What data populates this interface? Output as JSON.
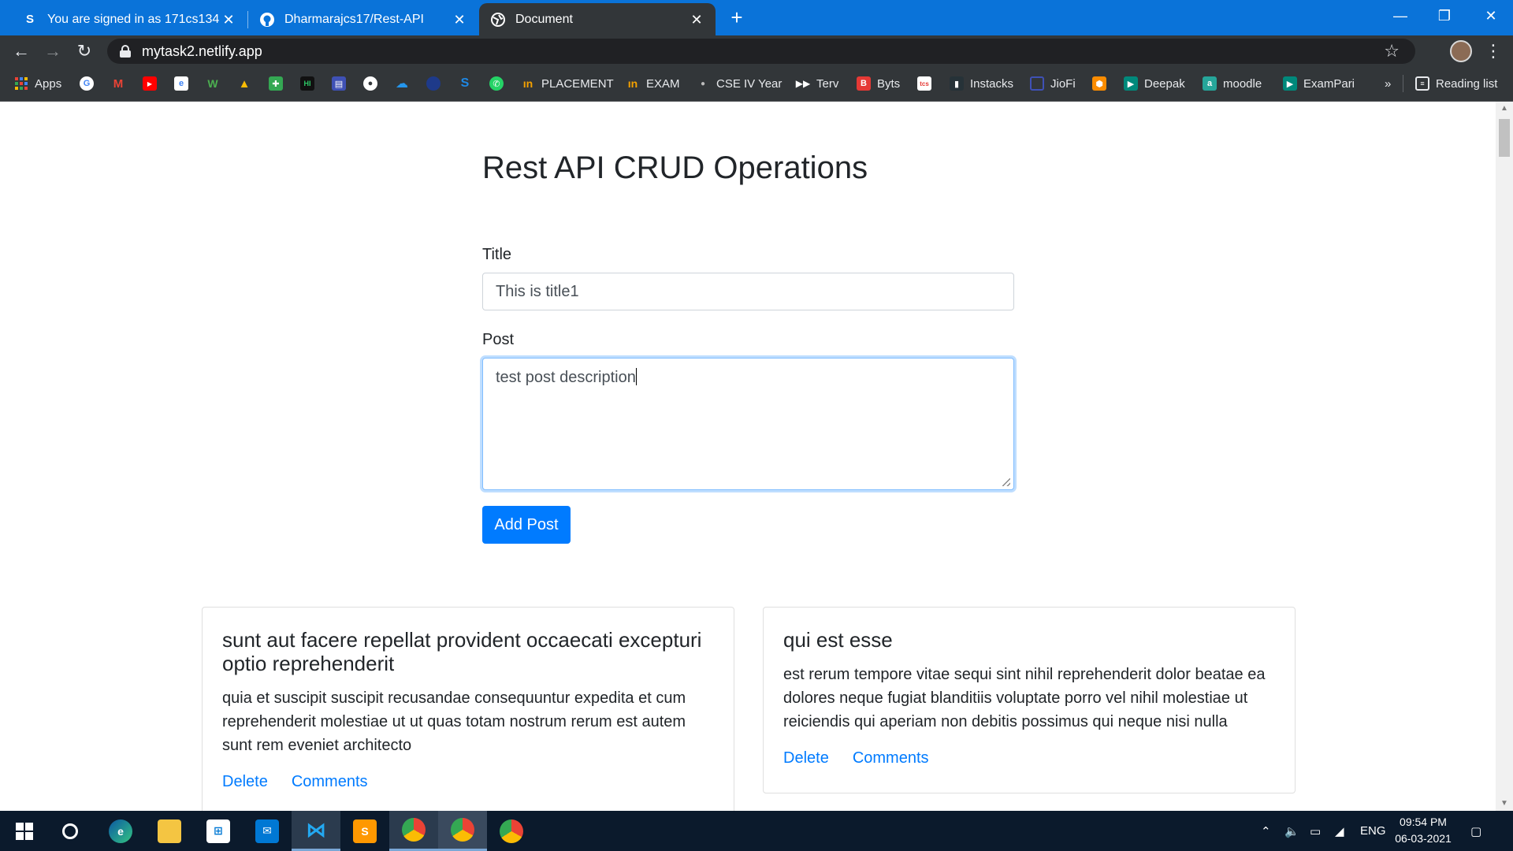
{
  "browser": {
    "tabs": [
      {
        "title": "You are signed in as 171cs134",
        "favicon": "S"
      },
      {
        "title": "Dharmarajcs17/Rest-API",
        "favicon": "github-icon"
      },
      {
        "title": "Document",
        "favicon": "globe-icon"
      }
    ],
    "url": "mytask2.netlify.app",
    "bookmarks": [
      {
        "label": "Apps",
        "icon": "apps-grid-icon",
        "color": "#ea4335"
      },
      {
        "label": "",
        "icon": "google-icon",
        "color": "#4285f4"
      },
      {
        "label": "",
        "icon": "gmail-icon",
        "color": "#ea4335"
      },
      {
        "label": "",
        "icon": "youtube-icon",
        "color": "#ff0000"
      },
      {
        "label": "",
        "icon": "editor-icon",
        "color": "#3b82f6"
      },
      {
        "label": "",
        "icon": "w-icon",
        "color": "#4caf50"
      },
      {
        "label": "",
        "icon": "drive-icon",
        "color": "#fbbc04"
      },
      {
        "label": "",
        "icon": "maps-icon",
        "color": "#34a853"
      },
      {
        "label": "",
        "icon": "hackerrank-icon",
        "color": "#111111"
      },
      {
        "label": "",
        "icon": "calendar-icon",
        "color": "#3f51b5"
      },
      {
        "label": "",
        "icon": "github-icon",
        "color": "#ffffff"
      },
      {
        "label": "",
        "icon": "docker-icon",
        "color": "#2496ed"
      },
      {
        "label": "",
        "icon": "dot-icon",
        "color": "#1e3a8a"
      },
      {
        "label": "",
        "icon": "s-icon",
        "color": "#1e88e5"
      },
      {
        "label": "",
        "icon": "whatsapp-icon",
        "color": "#25d366"
      },
      {
        "label": "PLACEMENT",
        "icon": "placement-icon",
        "color": "#f4a100"
      },
      {
        "label": "EXAM",
        "icon": "exam-icon",
        "color": "#f4a100"
      },
      {
        "label": "CSE IV Year",
        "icon": "dot-icon",
        "color": "#555555"
      },
      {
        "label": "Terv",
        "icon": "terv-icon",
        "color": "#ffffff"
      },
      {
        "label": "Byts",
        "icon": "byts-icon",
        "color": "#e53935"
      },
      {
        "label": "",
        "icon": "tcs-icon",
        "color": "#e53935"
      },
      {
        "label": "Instacks",
        "icon": "instacks-icon",
        "color": "#263238"
      },
      {
        "label": "JioFi",
        "icon": "jiofi-icon",
        "color": "#3f51b5"
      },
      {
        "label": "",
        "icon": "box-icon",
        "color": "#fb8c00"
      },
      {
        "label": "Deepak",
        "icon": "meet-icon",
        "color": "#00897b"
      },
      {
        "label": "moodle",
        "icon": "moodle-icon",
        "color": "#26a69a"
      },
      {
        "label": "ExamPari",
        "icon": "meet-icon",
        "color": "#00897b"
      }
    ],
    "reading_list": "Reading list",
    "more_bookmarks": "»"
  },
  "page": {
    "heading": "Rest API CRUD Operations",
    "title_label": "Title",
    "title_value": "This is title1",
    "post_label": "Post",
    "post_value": "test post description",
    "add_button": "Add Post",
    "posts": [
      {
        "title": "sunt aut facere repellat provident occaecati excepturi optio reprehenderit",
        "body": "quia et suscipit suscipit recusandae consequuntur expedita et cum reprehenderit molestiae ut ut quas totam nostrum rerum est autem sunt rem eveniet architecto",
        "delete": "Delete",
        "comments": "Comments"
      },
      {
        "title": "qui est esse",
        "body": "est rerum tempore vitae sequi sint nihil reprehenderit dolor beatae ea dolores neque fugiat blanditiis voluptate porro vel nihil molestiae ut reiciendis qui aperiam non debitis possimus qui neque nisi nulla",
        "delete": "Delete",
        "comments": "Comments"
      }
    ]
  },
  "taskbar": {
    "apps": [
      "edge-icon",
      "file-explorer-icon",
      "store-icon",
      "mail-icon",
      "vscode-icon",
      "sublime-icon",
      "chrome-icon",
      "chrome-icon",
      "chrome-icon"
    ],
    "language": "ENG",
    "time": "09:54 PM",
    "date": "06-03-2021"
  },
  "colors": {
    "accent": "#007bff",
    "tabstrip": "#0a73d9",
    "toolbar": "#323639"
  }
}
